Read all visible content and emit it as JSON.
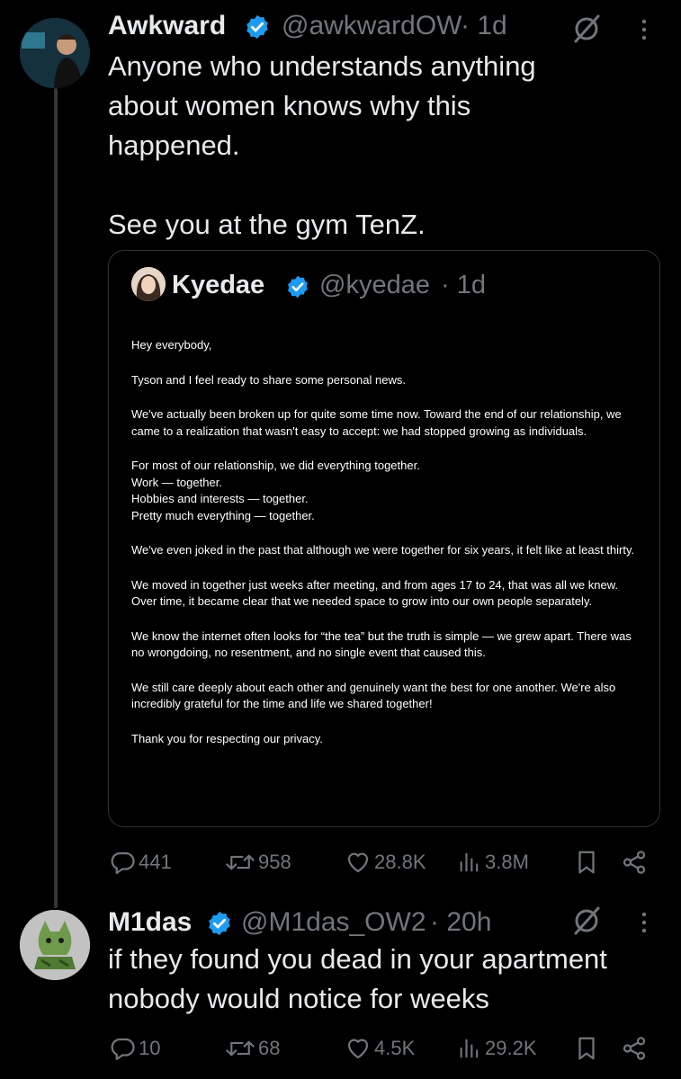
{
  "tweet1": {
    "display_name": "Awkward",
    "handle": "@awkwardOW",
    "time": "· 1d",
    "text_lines": [
      "Anyone who understands anything",
      "about women knows why this",
      "happened."
    ],
    "text_line2": "See you at the gym TenZ.",
    "quote": {
      "display_name": "Kyedae",
      "handle": "@kyedae",
      "time": "· 1d",
      "letter": [
        "Hey everybody,",
        "Tyson and I feel ready to share some personal news.",
        "We've actually been broken up for quite some time now. Toward the end of our relationship, we came to a realization that wasn't easy to accept: we had stopped growing as individuals.",
        "For most of our relationship, we did everything together.\nWork — together.\nHobbies and interests — together.\nPretty much everything — together.",
        "We've even joked in the past that although we were together for six years, it felt like at least thirty.",
        "We moved in together just weeks after meeting, and from ages 17 to 24, that was all we knew. Over time, it became clear that we needed space to grow into our own people separately.",
        "We know the internet often looks for “the tea” but the truth is simple — we grew apart. There was no wrongdoing, no resentment, and no single event that caused this.",
        "We still care deeply about each other and genuinely want the best for one another. We're also incredibly grateful for the time and life we shared together!",
        "Thank you for respecting our privacy."
      ]
    },
    "stats": {
      "replies": "441",
      "reposts": "958",
      "likes": "28.8K",
      "views": "3.8M"
    }
  },
  "tweet2": {
    "display_name": "M1das",
    "handle": "@M1das_OW2",
    "time": "· 20h",
    "text_lines": [
      "if they found you dead in your apartment",
      "nobody would notice for weeks"
    ],
    "stats": {
      "replies": "10",
      "reposts": "68",
      "likes": "4.5K",
      "views": "29.2K"
    }
  },
  "icons": [
    "verified-badge-icon",
    "grok-icon",
    "more-icon",
    "reply-icon",
    "repost-icon",
    "like-icon",
    "views-icon",
    "bookmark-icon",
    "share-icon"
  ],
  "colors": {
    "background": "#000000",
    "text": "#e7e9ea",
    "muted": "#71767b",
    "verified": "#1d9bf0",
    "border": "#2f3336"
  }
}
